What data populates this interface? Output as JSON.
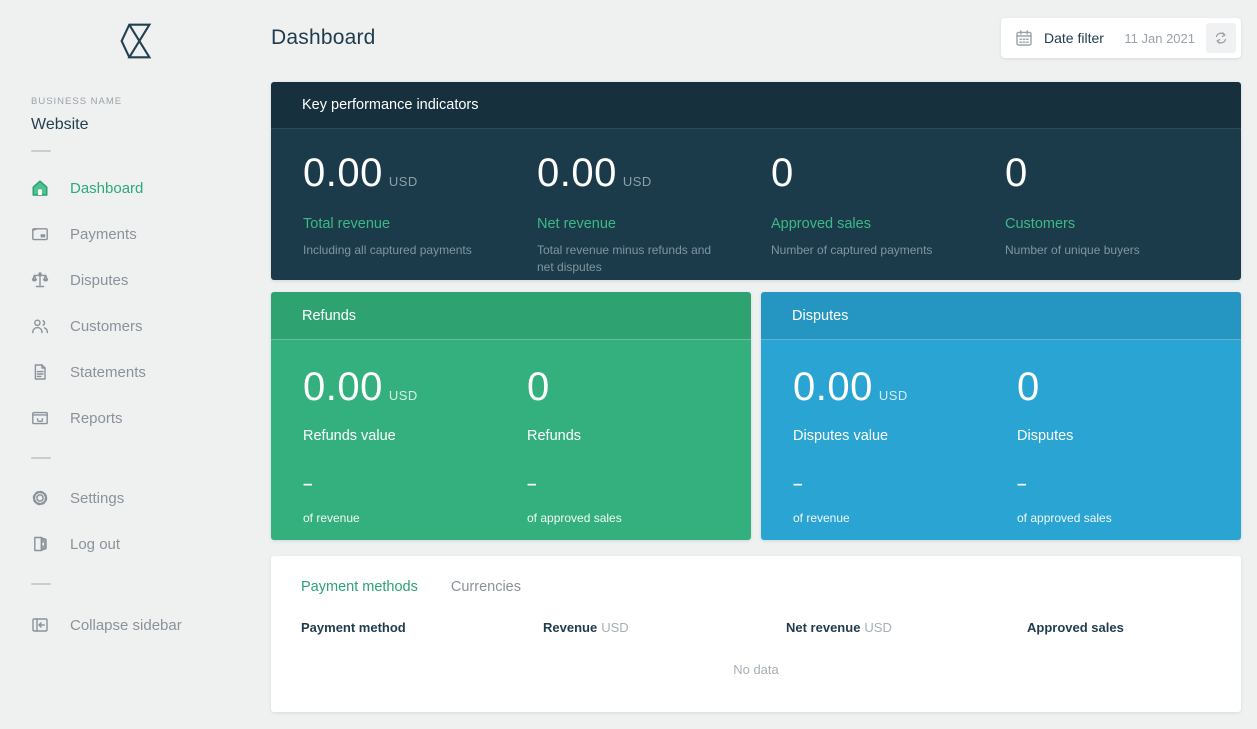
{
  "colors": {
    "accent_green": "#2BA275",
    "page_background": "#EFF1F1",
    "panel_dark_header": "#16303D",
    "panel_dark_body": "#1C3B4A",
    "panel_green_header": "#2EA371",
    "panel_green_body": "#33B07D",
    "panel_blue_header": "#2596C1",
    "panel_blue_body": "#2AA4D2",
    "text_dark": "#1F3B4D",
    "text_gray": "#8A929A"
  },
  "sidebar": {
    "logo_icon": "checkout-logo",
    "business_label": "BUSINESS NAME",
    "business_name": "Website",
    "items": [
      {
        "icon": "home-icon",
        "label": "Dashboard",
        "active": true
      },
      {
        "icon": "wallet-icon",
        "label": "Payments",
        "active": false
      },
      {
        "icon": "scales-icon",
        "label": "Disputes",
        "active": false
      },
      {
        "icon": "people-icon",
        "label": "Customers",
        "active": false
      },
      {
        "icon": "document-icon",
        "label": "Statements",
        "active": false
      },
      {
        "icon": "inbox-icon",
        "label": "Reports",
        "active": false
      }
    ],
    "secondary_items": [
      {
        "icon": "gear-icon",
        "label": "Settings"
      },
      {
        "icon": "door-icon",
        "label": "Log out"
      }
    ],
    "collapse": {
      "icon": "collapse-icon",
      "label": "Collapse sidebar"
    }
  },
  "header": {
    "title": "Dashboard",
    "date_filter": {
      "icon": "calendar-icon",
      "label": "Date filter",
      "value": "11 Jan 2021",
      "refresh_icon": "refresh-icon"
    }
  },
  "kpi": {
    "title": "Key performance indicators",
    "metrics": [
      {
        "value": "0.00",
        "unit": "USD",
        "label": "Total revenue",
        "description": "Including all captured payments"
      },
      {
        "value": "0.00",
        "unit": "USD",
        "label": "Net revenue",
        "description": "Total revenue minus refunds and net disputes"
      },
      {
        "value": "0",
        "unit": "",
        "label": "Approved sales",
        "description": "Number of captured payments"
      },
      {
        "value": "0",
        "unit": "",
        "label": "Customers",
        "description": "Number of unique buyers"
      }
    ]
  },
  "refunds": {
    "title": "Refunds",
    "metrics": [
      {
        "value": "0.00",
        "unit": "USD",
        "label": "Refunds value",
        "ratio": "–",
        "ratio_label": "of revenue"
      },
      {
        "value": "0",
        "unit": "",
        "label": "Refunds",
        "ratio": "–",
        "ratio_label": "of approved sales"
      }
    ]
  },
  "disputes": {
    "title": "Disputes",
    "metrics": [
      {
        "value": "0.00",
        "unit": "USD",
        "label": "Disputes value",
        "ratio": "–",
        "ratio_label": "of revenue"
      },
      {
        "value": "0",
        "unit": "",
        "label": "Disputes",
        "ratio": "–",
        "ratio_label": "of approved sales"
      }
    ]
  },
  "breakdown": {
    "tabs": [
      {
        "label": "Payment methods",
        "active": true
      },
      {
        "label": "Currencies",
        "active": false
      }
    ],
    "columns": [
      {
        "label": "Payment method",
        "unit": ""
      },
      {
        "label": "Revenue",
        "unit": "USD"
      },
      {
        "label": "Net revenue",
        "unit": "USD"
      },
      {
        "label": "Approved sales",
        "unit": ""
      }
    ],
    "empty_text": "No data"
  }
}
